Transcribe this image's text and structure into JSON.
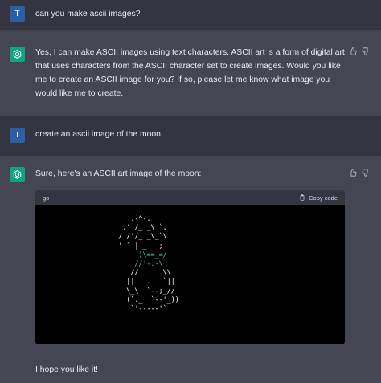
{
  "messages": [
    {
      "role": "user",
      "avatar_letter": "T",
      "text": "can you make ascii images?"
    },
    {
      "role": "assistant",
      "text": "Yes, I can make ASCII images using text characters. ASCII art is a form of digital art that uses characters from the ASCII character set to create images. Would you like me to create an ASCII image for you? If so, please let me know what image you would like me to create."
    },
    {
      "role": "user",
      "avatar_letter": "T",
      "text": "create an ascii image of the moon"
    },
    {
      "role": "assistant",
      "text": "Sure, here's an ASCII art image of the moon:",
      "after_text": "I hope you like it!"
    }
  ],
  "code_block": {
    "language": "go",
    "copy_label": "Copy code",
    "lines": [
      "        .-^-.",
      "      .' /_ _\\ `.",
      "     / /'/_ _\\_`\\",
      "     ' ` | _   ;",
      "          )\\==_=/",
      "         //'-.-\\",
      "        //      \\\\",
      "       ||   .   `||",
      "       \\_\\  `--;_//",
      "       (`._  `--'_))",
      "        `'-----'`"
    ]
  },
  "icons": {
    "assistant_avatar": "openai-logo-icon",
    "thumbs_up": "thumbs-up-icon",
    "thumbs_down": "thumbs-down-icon",
    "copy": "clipboard-icon"
  },
  "colors": {
    "user_bg": "#343541",
    "assistant_bg": "#444654",
    "assistant_avatar": "#10a37f",
    "user_avatar": "#2b5fa3"
  }
}
